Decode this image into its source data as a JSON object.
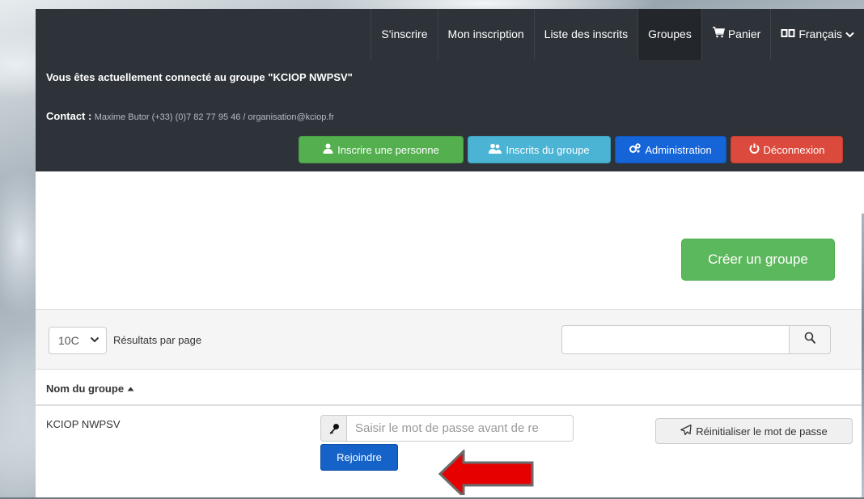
{
  "nav": {
    "items": [
      {
        "label": "S'inscrire",
        "active": false
      },
      {
        "label": "Mon inscription",
        "active": false
      },
      {
        "label": "Liste des inscrits",
        "active": false
      },
      {
        "label": "Groupes",
        "active": true
      },
      {
        "label": "Panier",
        "icon": "cart-icon",
        "active": false
      },
      {
        "label": "Français",
        "icon": "language-icon",
        "active": false
      }
    ]
  },
  "header": {
    "connected_text": "Vous êtes actuellement connecté au groupe \"KCIOP NWPSV\"",
    "contact_label": "Contact :",
    "contact_value": "Maxime Butor (+33) (0)7 82 77 95 46 / organisation@kciop.fr",
    "buttons": {
      "register_person": "Inscrire une personne",
      "group_members": "Inscrits du groupe",
      "administration": "Administration",
      "logout": "Déconnexion"
    }
  },
  "groups_page": {
    "create_button": "Créer un groupe",
    "per_page_value": "10C",
    "per_page_label": "Résultats par page",
    "search_value": "",
    "column_header": "Nom du groupe",
    "rows": [
      {
        "name": "KCIOP NWPSV",
        "password_placeholder": "Saisir le mot de passe avant de re",
        "join_label": "Rejoindre",
        "reset_label": "Réinitialiser le mot de passe"
      }
    ]
  },
  "colors": {
    "header_bg": "#2e3339",
    "green": "#54b04f",
    "teal": "#4bb3d4",
    "blue": "#1565d8",
    "red": "#dc4a3d",
    "create_green": "#5cb85c",
    "arrow_red": "#e60000"
  }
}
